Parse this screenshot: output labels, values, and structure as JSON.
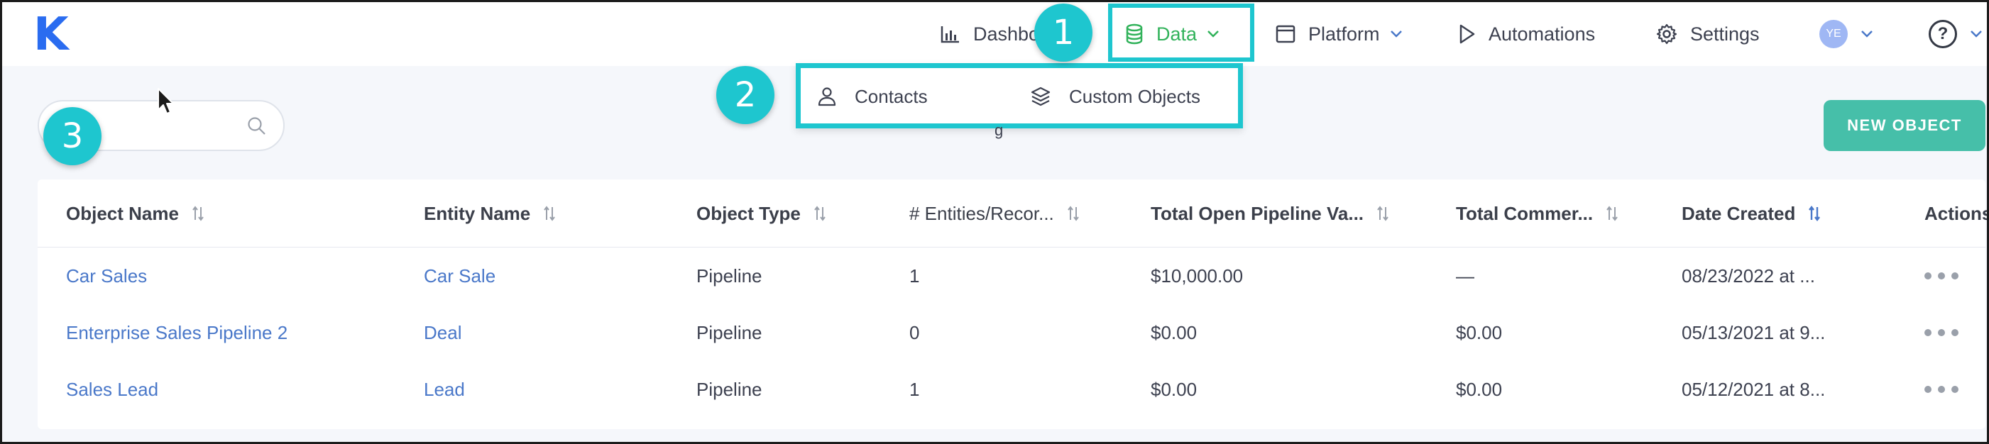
{
  "app": {
    "logo": "K"
  },
  "nav": {
    "dashboard": "Dashbo",
    "data": "Data",
    "platform": "Platform",
    "automations": "Automations",
    "settings": "Settings",
    "avatar_initials": "YE",
    "help": "?"
  },
  "dropdown": {
    "contacts": "Contacts",
    "custom_objects": "Custom Objects"
  },
  "callouts": [
    "1",
    "2",
    "3"
  ],
  "search": {
    "placeholder": ""
  },
  "toolbar": {
    "partial_title": "g",
    "new_object_label": "NEW OBJECT"
  },
  "table": {
    "headers": [
      "Object Name",
      "Entity Name",
      "Object Type",
      "# Entities/Recor...",
      "Total Open Pipeline Va...",
      "Total Commer...",
      "Date Created",
      "Actions"
    ],
    "rows": [
      [
        "Car Sales",
        "Car Sale",
        "Pipeline",
        "1",
        "$10,000.00",
        "—",
        "08/23/2022 at ..."
      ],
      [
        "Enterprise Sales Pipeline 2",
        "Deal",
        "Pipeline",
        "0",
        "$0.00",
        "$0.00",
        "05/13/2021 at 9..."
      ],
      [
        "Sales Lead",
        "Lead",
        "Pipeline",
        "1",
        "$0.00",
        "$0.00",
        "05/12/2021 at 8..."
      ]
    ]
  },
  "colors": {
    "accent_highlight": "#1ec6cf",
    "brand_blue": "#2a6cf0",
    "active_green": "#31b25a",
    "button_teal": "#46bfa9",
    "link_blue": "#4a78c9"
  },
  "icons": {
    "dashboard": "bar-chart-icon",
    "data": "database-icon",
    "platform": "window-icon",
    "automations": "play-icon",
    "settings": "gear-icon",
    "contacts": "person-icon",
    "custom_objects": "layers-icon",
    "search": "search-icon",
    "sort": "sort-icon"
  }
}
